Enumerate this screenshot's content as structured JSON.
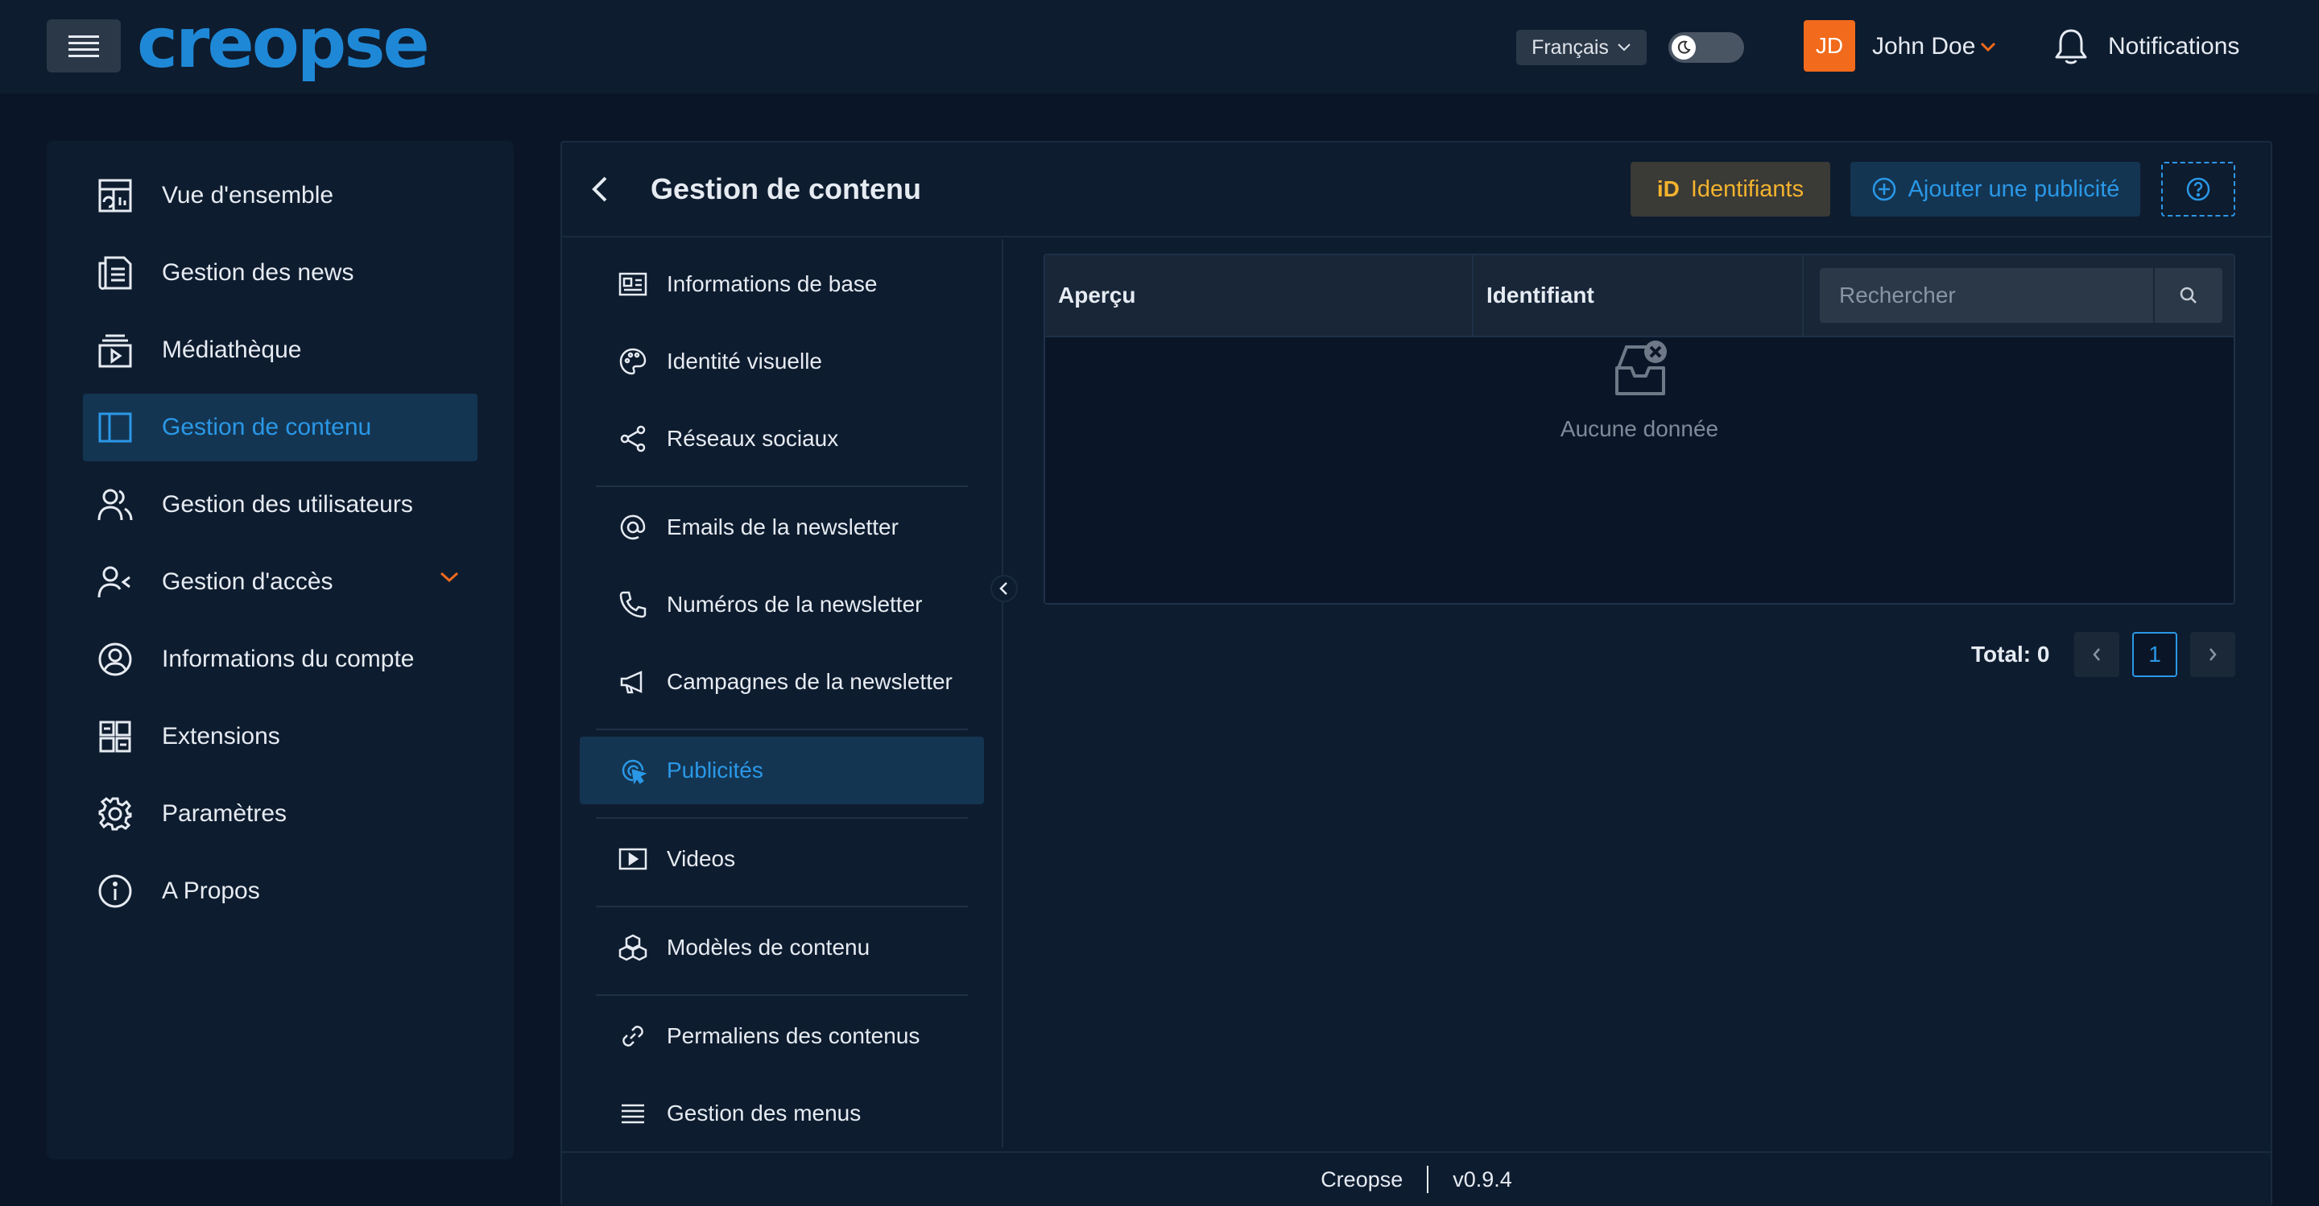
{
  "header": {
    "logo": "creopse",
    "language": "Français",
    "avatar_initials": "JD",
    "username": "John Doe",
    "notifications_label": "Notifications"
  },
  "sidebar": {
    "items": [
      {
        "label": "Vue d'ensemble",
        "icon": "dashboard-icon"
      },
      {
        "label": "Gestion des news",
        "icon": "newspaper-icon"
      },
      {
        "label": "Médiathèque",
        "icon": "media-library-icon"
      },
      {
        "label": "Gestion de contenu",
        "icon": "layout-icon",
        "active": true
      },
      {
        "label": "Gestion des utilisateurs",
        "icon": "users-icon"
      },
      {
        "label": "Gestion d'accès",
        "icon": "user-access-icon",
        "expandable": true
      },
      {
        "label": "Informations du compte",
        "icon": "account-circle-icon"
      },
      {
        "label": "Extensions",
        "icon": "extensions-icon"
      },
      {
        "label": "Paramètres",
        "icon": "gear-icon"
      },
      {
        "label": "A Propos",
        "icon": "info-icon"
      }
    ]
  },
  "main": {
    "title": "Gestion de contenu",
    "buttons": {
      "identifiers_badge": "iD",
      "identifiers": "Identifiants",
      "add_ad": "Ajouter une publicité"
    },
    "submenu": [
      {
        "label": "Informations de base",
        "icon": "id-card-icon"
      },
      {
        "label": "Identité visuelle",
        "icon": "palette-icon"
      },
      {
        "label": "Réseaux sociaux",
        "icon": "share-icon"
      },
      {
        "label": "Emails de la newsletter",
        "icon": "at-icon"
      },
      {
        "label": "Numéros de la newsletter",
        "icon": "phone-icon"
      },
      {
        "label": "Campagnes de la newsletter",
        "icon": "megaphone-icon"
      },
      {
        "label": "Publicités",
        "icon": "cursor-click-icon",
        "active": true
      },
      {
        "label": "Videos",
        "icon": "video-icon"
      },
      {
        "label": "Modèles de contenu",
        "icon": "blocks-icon"
      },
      {
        "label": "Permaliens des contenus",
        "icon": "link-icon"
      },
      {
        "label": "Gestion des menus",
        "icon": "menu-lines-icon"
      }
    ],
    "table": {
      "columns": [
        "Aperçu",
        "Identifiant"
      ],
      "search_placeholder": "Rechercher",
      "empty_text": "Aucune donnée"
    },
    "pagination": {
      "total_label": "Total: 0",
      "current_page": "1"
    }
  },
  "footer": {
    "app_name": "Creopse",
    "version": "v0.9.4"
  },
  "colors": {
    "background": "#0a1628",
    "panel": "#0e1c2f",
    "accent": "#2a98e6",
    "active_bg": "#143552",
    "avatar": "#f26a1b",
    "identifiers_text": "#f3b32e"
  }
}
